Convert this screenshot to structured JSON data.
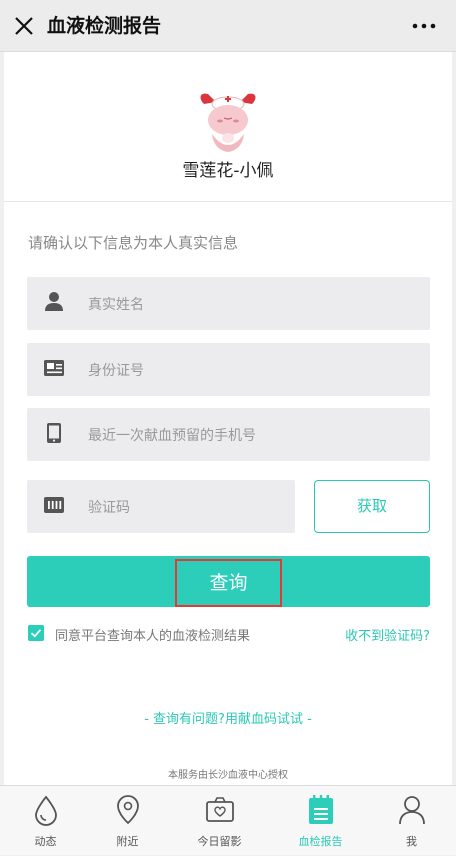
{
  "header": {
    "title": "血液检测报告"
  },
  "profile": {
    "nickname": "雪莲花-小佩"
  },
  "form": {
    "prompt": "请确认以下信息为本人真实信息",
    "name_placeholder": "真实姓名",
    "id_placeholder": "身份证号",
    "phone_placeholder": "最近一次献血预留的手机号",
    "code_placeholder": "验证码",
    "get_code_label": "获取",
    "query_label": "查询",
    "agree_text": "同意平台查询本人的血液检测结果",
    "agree_checked": true,
    "no_code_link": "收不到验证码?",
    "help_link": "- 查询有问题?用献血码试试 -",
    "authorization": "本服务由长沙血液中心授权"
  },
  "tabs": [
    {
      "label": "动态",
      "icon": "blood-drop-icon"
    },
    {
      "label": "附近",
      "icon": "location-pin-icon"
    },
    {
      "label": "今日留影",
      "icon": "camera-icon"
    },
    {
      "label": "血检报告",
      "icon": "report-icon",
      "active": true
    },
    {
      "label": "我",
      "icon": "person-icon"
    }
  ],
  "colors": {
    "accent": "#2ccdb9",
    "highlight": "#e53935"
  }
}
